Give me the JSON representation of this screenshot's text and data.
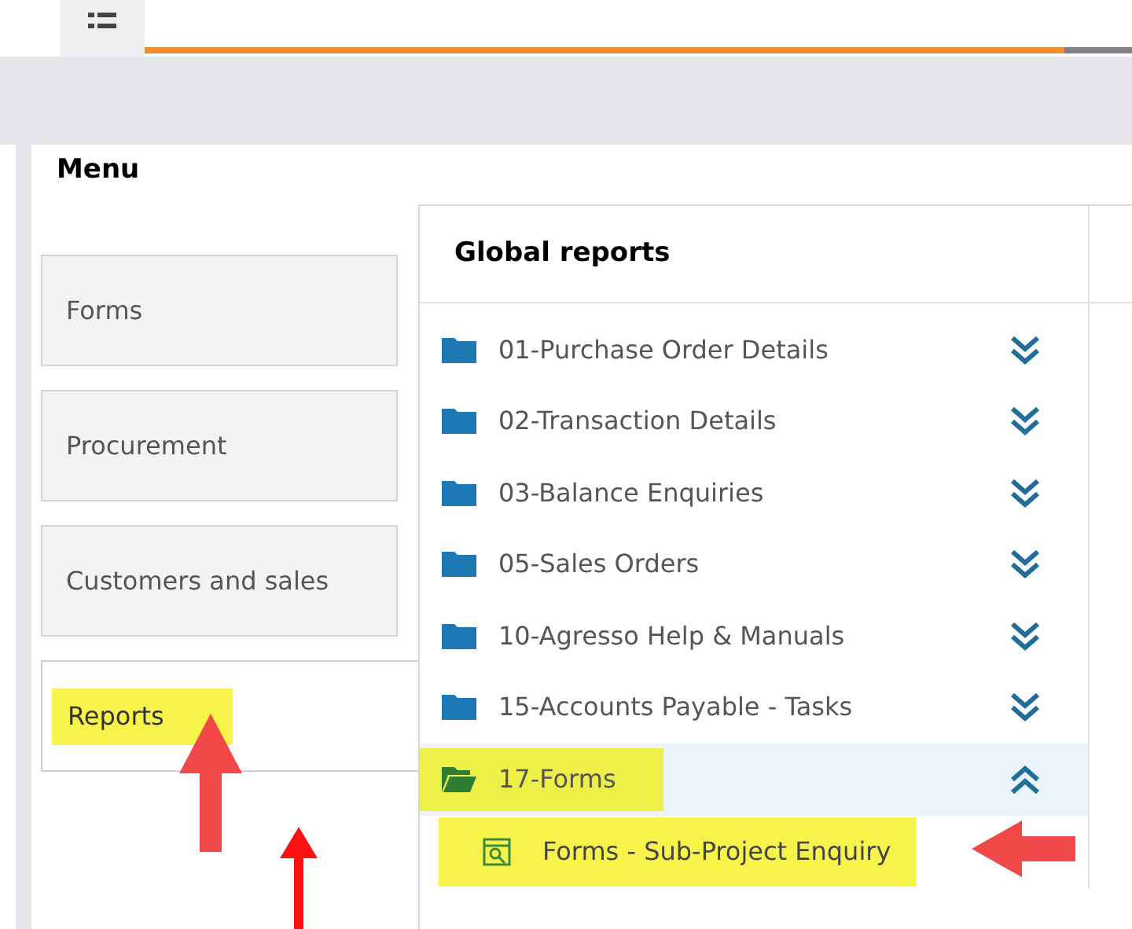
{
  "menu": {
    "title": "Menu",
    "items": [
      {
        "label": "Forms",
        "selected": false,
        "highlighted": false
      },
      {
        "label": "Procurement",
        "selected": false,
        "highlighted": false
      },
      {
        "label": "Customers and sales",
        "selected": false,
        "highlighted": false
      },
      {
        "label": "Reports",
        "selected": true,
        "highlighted": true
      }
    ]
  },
  "reports": {
    "title": "Global reports",
    "folders": [
      {
        "label": "01-Purchase Order Details",
        "expanded": false,
        "highlighted": false
      },
      {
        "label": "02-Transaction Details",
        "expanded": false,
        "highlighted": false
      },
      {
        "label": "03-Balance Enquiries",
        "expanded": false,
        "highlighted": false
      },
      {
        "label": "05-Sales Orders",
        "expanded": false,
        "highlighted": false
      },
      {
        "label": "10-Agresso Help & Manuals",
        "expanded": false,
        "highlighted": false
      },
      {
        "label": "15-Accounts Payable - Tasks",
        "expanded": false,
        "highlighted": false
      },
      {
        "label": "17-Forms",
        "expanded": true,
        "highlighted": true,
        "children": [
          {
            "label": "Forms - Sub-Project Enquiry",
            "highlighted": true
          }
        ]
      }
    ]
  }
}
